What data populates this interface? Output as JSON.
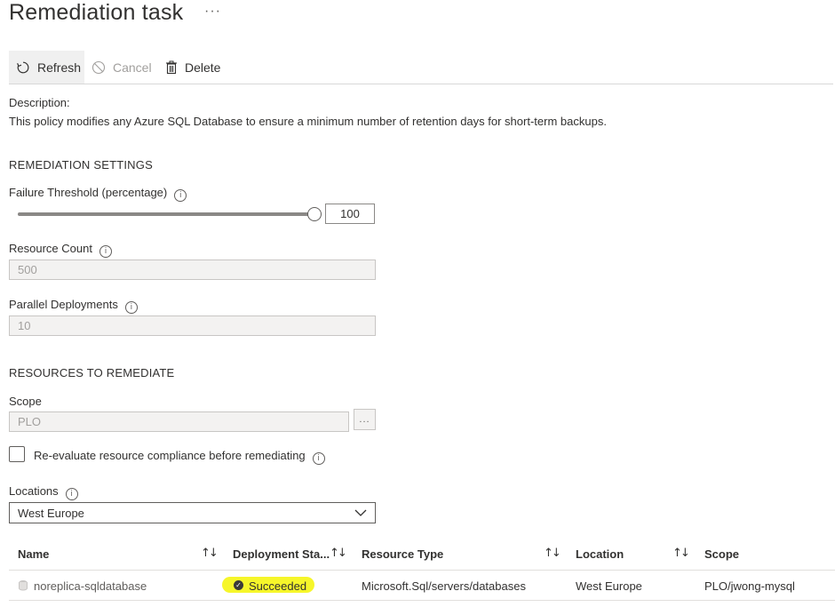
{
  "header": {
    "title": "Remediation task",
    "more": "···"
  },
  "toolbar": {
    "refresh": "Refresh",
    "cancel": "Cancel",
    "delete": "Delete"
  },
  "description": {
    "label": "Description:",
    "text": "This policy modifies any Azure SQL Database to ensure a minimum number of retention days for short-term backups."
  },
  "remediation_settings": {
    "heading": "REMEDIATION SETTINGS",
    "failure_threshold": {
      "label": "Failure Threshold (percentage)",
      "value": "100",
      "fraction": 1.0
    },
    "resource_count": {
      "label": "Resource Count",
      "value": "500"
    },
    "parallel_deployments": {
      "label": "Parallel Deployments",
      "value": "10"
    }
  },
  "resources": {
    "heading": "RESOURCES TO REMEDIATE",
    "scope": {
      "label": "Scope",
      "value": "PLO",
      "browse": "..."
    },
    "reevaluate": {
      "label": "Re-evaluate resource compliance before remediating",
      "checked": false
    },
    "locations": {
      "label": "Locations",
      "value": "West Europe"
    }
  },
  "grid": {
    "columns": [
      "Name",
      "Deployment Sta...",
      "Resource Type",
      "Location",
      "Scope"
    ],
    "rows": [
      {
        "name": "noreplica-sqldatabase",
        "status": "Succeeded",
        "resource_type": "Microsoft.Sql/servers/databases",
        "location": "West Europe",
        "scope": "PLO/jwong-mysql"
      }
    ]
  },
  "icons": {
    "info": "i",
    "sort": "↑↓",
    "success": "✓"
  },
  "colors": {
    "highlight": "#f6f62a",
    "accent": "#323130"
  }
}
